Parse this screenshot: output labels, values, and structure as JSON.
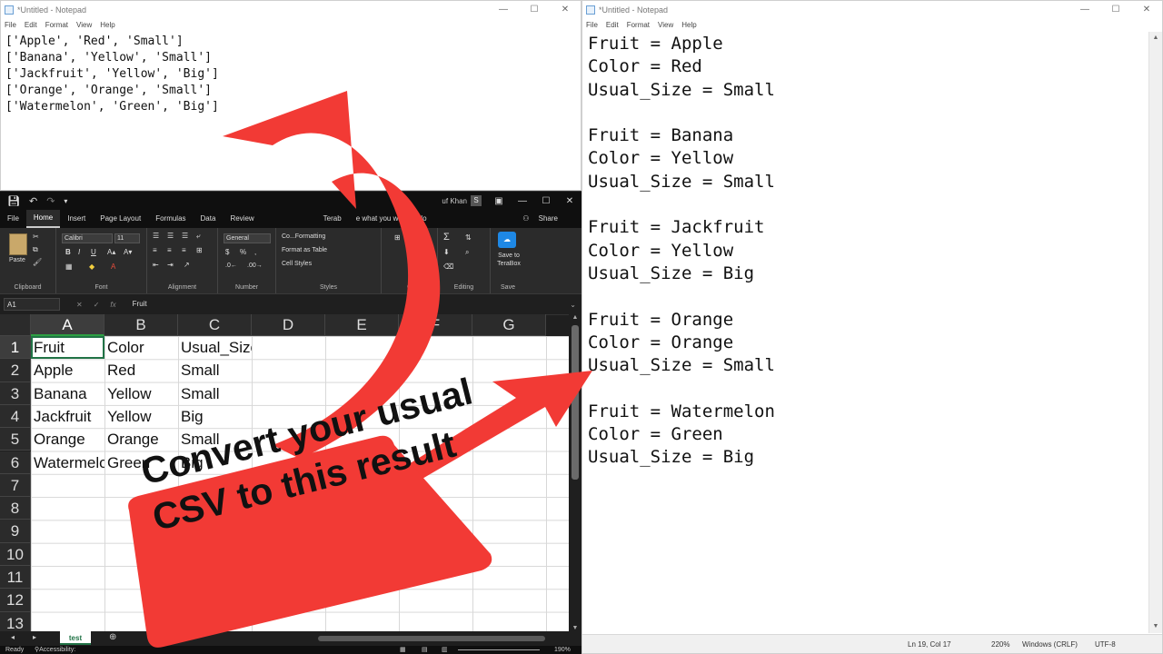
{
  "notepad_left": {
    "title": "*Untitled - Notepad",
    "menu": [
      "File",
      "Edit",
      "Format",
      "View",
      "Help"
    ],
    "lines": [
      "['Apple', 'Red', 'Small']",
      "['Banana', 'Yellow', 'Small']",
      "['Jackfruit', 'Yellow', 'Big']",
      "['Orange', 'Orange', 'Small']",
      "['Watermelon', 'Green', 'Big']"
    ]
  },
  "notepad_right": {
    "title": "*Untitled - Notepad",
    "menu": [
      "File",
      "Edit",
      "Format",
      "View",
      "Help"
    ],
    "lines": [
      "Fruit = Apple",
      "Color = Red",
      "Usual_Size = Small",
      "",
      "Fruit = Banana",
      "Color = Yellow",
      "Usual_Size = Small",
      "",
      "Fruit = Jackfruit",
      "Color = Yellow",
      "Usual_Size = Big",
      "",
      "Fruit = Orange",
      "Color = Orange",
      "Usual_Size = Small",
      "",
      "Fruit = Watermelon",
      "Color = Green",
      "Usual_Size = Big"
    ],
    "status": {
      "position": "Ln 19, Col 17",
      "zoom": "220%",
      "line_ending": "Windows (CRLF)",
      "encoding": "UTF-8"
    }
  },
  "excel": {
    "user": "uf Khan",
    "user_initial": "S",
    "tabs": [
      "File",
      "Home",
      "Insert",
      "Page Layout",
      "Formulas",
      "Data",
      "Review",
      "Terab",
      "e what you want to do"
    ],
    "active_tab": "Home",
    "share": "Share",
    "ribbon": {
      "paste": "Paste",
      "font_name": "Calibri",
      "font_size": "11",
      "number_format": "General",
      "conditional_formatting": "Co...Formatting",
      "format_table": "Format as Table",
      "cell_styles": "Cell Styles",
      "save_terabox": "Save to TeraBox",
      "groups": {
        "clipboard": "Clipboard",
        "font": "Font",
        "alignment": "Alignment",
        "number": "Number",
        "styles": "Styles",
        "cells": "C",
        "editing": "Editing",
        "save": "Save"
      }
    },
    "name_box": "A1",
    "formula": "Fruit",
    "columns": [
      "A",
      "B",
      "C",
      "D",
      "E",
      "F",
      "G"
    ],
    "rows": [
      "1",
      "2",
      "3",
      "4",
      "5",
      "6",
      "7",
      "8",
      "9",
      "10",
      "11",
      "12",
      "13"
    ],
    "data": [
      [
        "Fruit",
        "Color",
        "Usual_Size"
      ],
      [
        "Apple",
        "Red",
        "Small"
      ],
      [
        "Banana",
        "Yellow",
        "Small"
      ],
      [
        "Jackfruit",
        "Yellow",
        "Big"
      ],
      [
        "Orange",
        "Orange",
        "Small"
      ],
      [
        "Watermelon",
        "Green",
        "Big"
      ]
    ],
    "sheet_tab": "test",
    "status": {
      "ready": "Ready",
      "accessibility": "Accessibility: Unavailable",
      "zoom": "190%"
    }
  },
  "callout": {
    "text": "Convert your usual CSV to this result",
    "color": "#f23a35"
  }
}
